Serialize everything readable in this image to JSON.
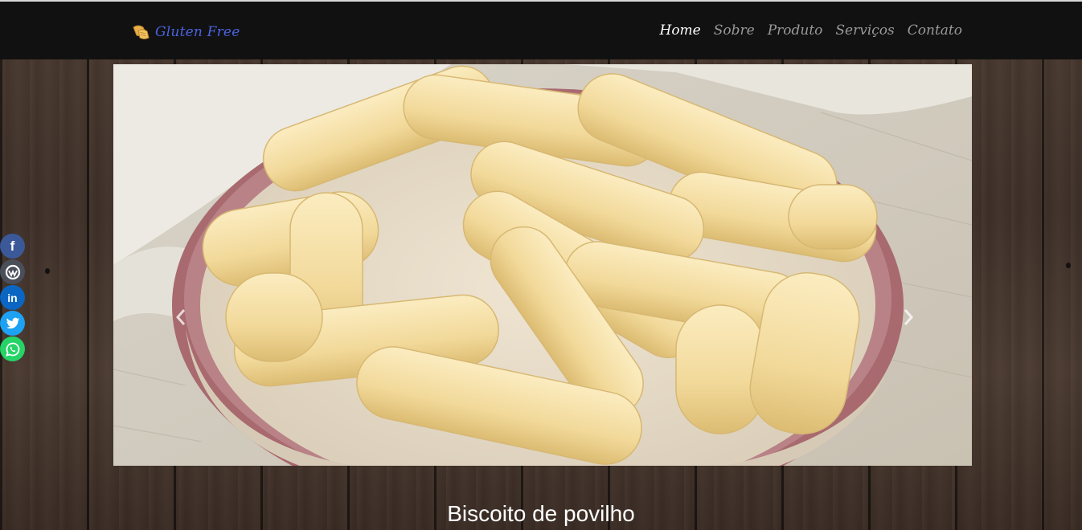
{
  "brand": {
    "name": "Gluten Free",
    "icon": "bread-icon",
    "color": "#4a63e0"
  },
  "nav": {
    "items": [
      {
        "label": "Home",
        "active": true
      },
      {
        "label": "Sobre",
        "active": false
      },
      {
        "label": "Produto",
        "active": false
      },
      {
        "label": "Serviços",
        "active": false
      },
      {
        "label": "Contato",
        "active": false
      }
    ]
  },
  "carousel": {
    "image": "bowl-of-polvilho-biscuits",
    "prev_icon": "chevron-left-icon",
    "next_icon": "chevron-right-icon",
    "caption": "Biscoito de povilho"
  },
  "share": [
    {
      "name": "facebook",
      "icon": "facebook-icon",
      "color": "#3b5998"
    },
    {
      "name": "workplace",
      "icon": "workplace-icon",
      "color": "#4a4f5a"
    },
    {
      "name": "linkedin",
      "icon": "linkedin-icon",
      "color": "#0a66c2"
    },
    {
      "name": "twitter",
      "icon": "twitter-icon",
      "color": "#1da1f2"
    },
    {
      "name": "whatsapp",
      "icon": "whatsapp-icon",
      "color": "#25d366"
    }
  ]
}
